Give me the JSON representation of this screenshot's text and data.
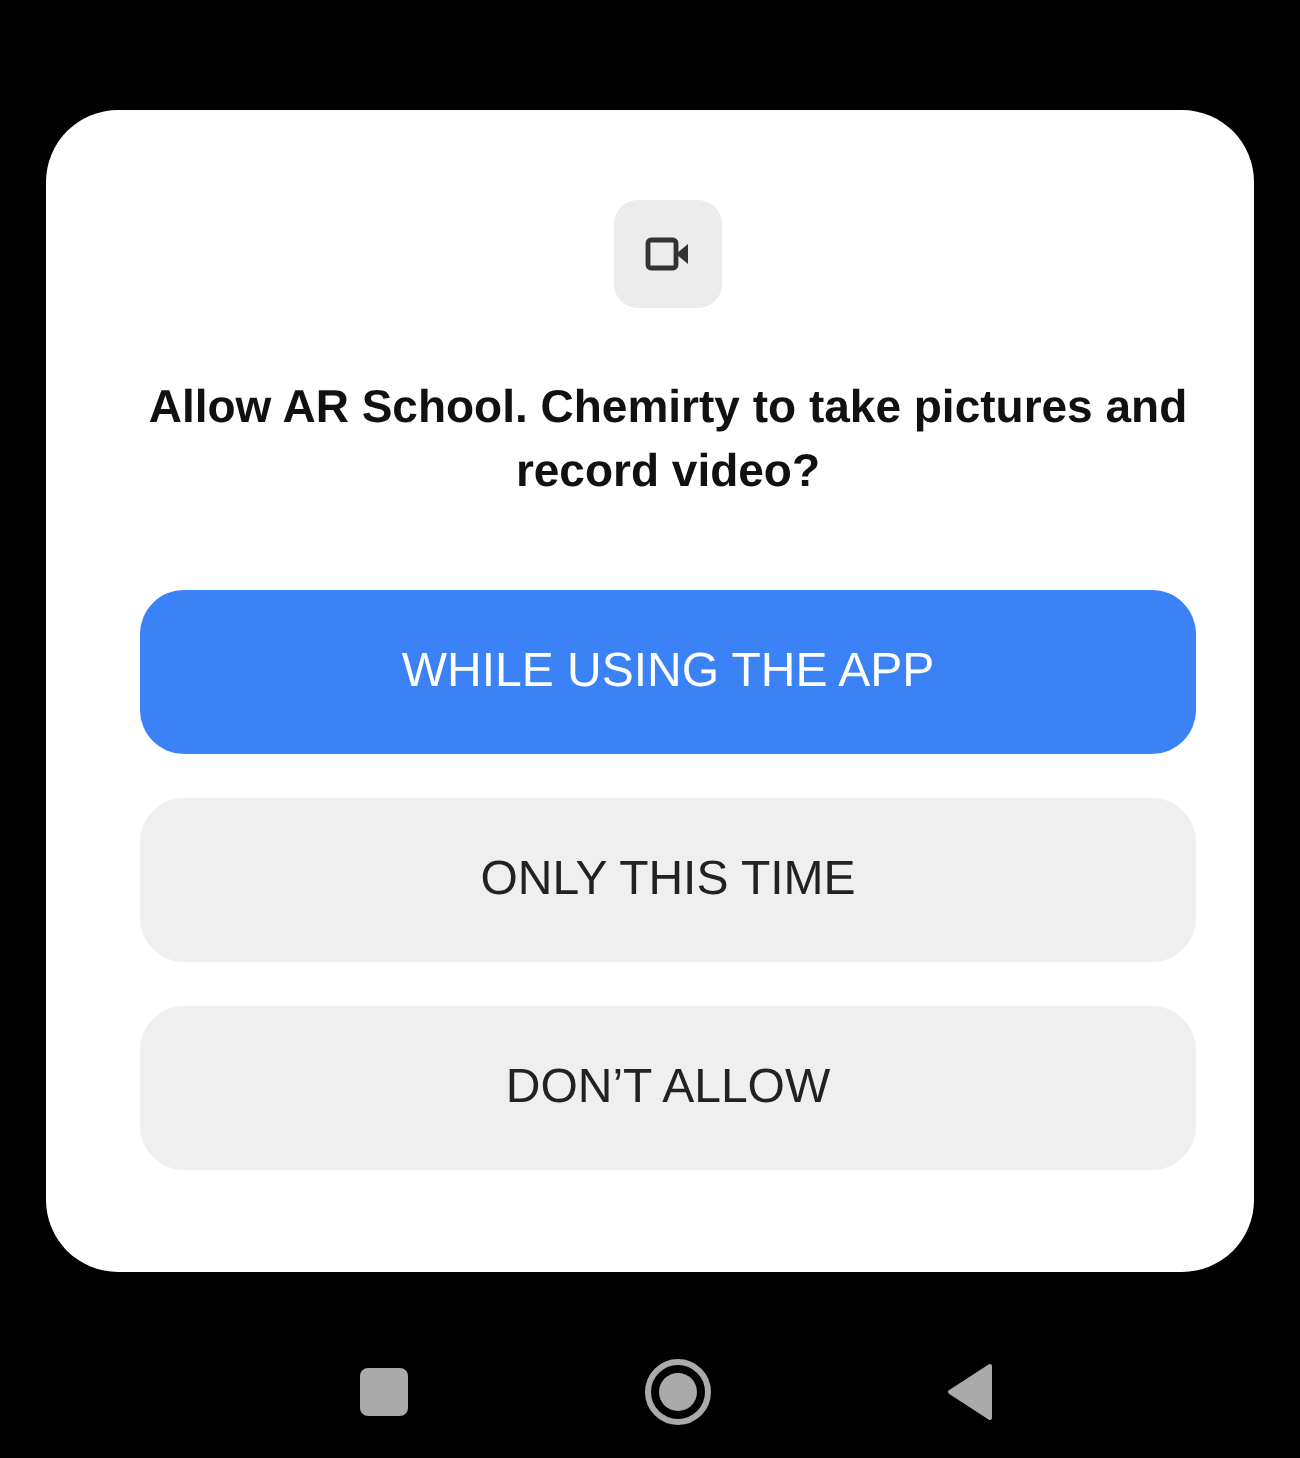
{
  "dialog": {
    "title": "Allow AR School. Chemirty to take pictures and record video?",
    "buttons": [
      {
        "label": "WHILE USING THE APP",
        "kind": "primary"
      },
      {
        "label": "ONLY THIS TIME",
        "kind": "secondary"
      },
      {
        "label": "DON’T ALLOW",
        "kind": "secondary"
      }
    ]
  }
}
